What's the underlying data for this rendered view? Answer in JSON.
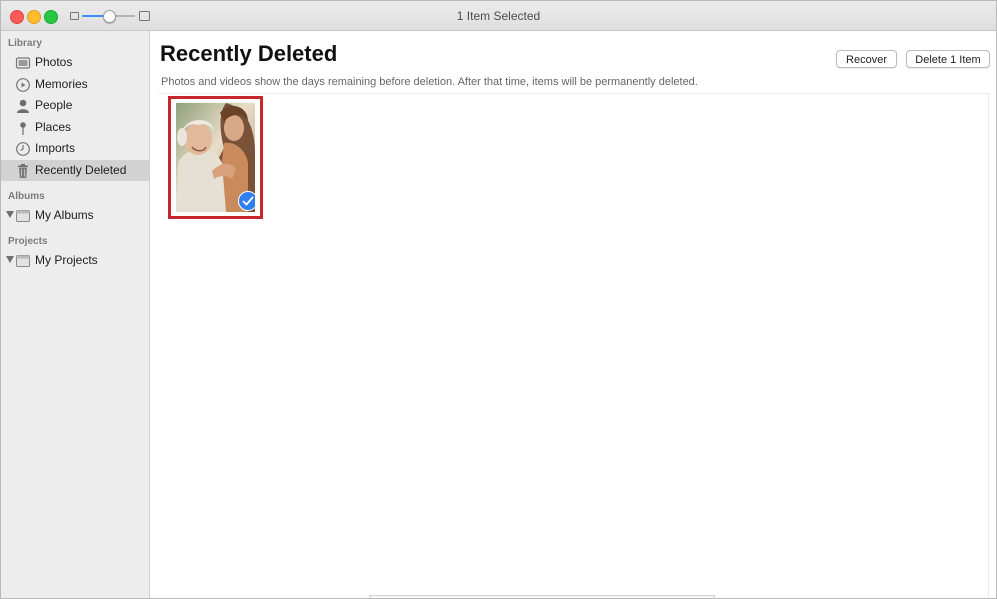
{
  "window": {
    "title": "1 Item Selected"
  },
  "toolbar": {
    "zoom_level": 0.5
  },
  "sidebar": {
    "sections": [
      {
        "label": "Library",
        "items": [
          {
            "label": "Photos",
            "icon": "photos-icon"
          },
          {
            "label": "Memories",
            "icon": "memories-icon"
          },
          {
            "label": "People",
            "icon": "people-icon"
          },
          {
            "label": "Places",
            "icon": "places-icon"
          },
          {
            "label": "Imports",
            "icon": "imports-icon"
          },
          {
            "label": "Recently Deleted",
            "icon": "trash-icon",
            "selected": true
          }
        ]
      },
      {
        "label": "Albums",
        "items": [
          {
            "label": "My Albums",
            "icon": "folder-icon"
          }
        ]
      },
      {
        "label": "Projects",
        "items": [
          {
            "label": "My Projects",
            "icon": "folder-icon"
          }
        ]
      }
    ]
  },
  "main": {
    "title": "Recently Deleted",
    "subtitle": "Photos and videos show the days remaining before deletion. After that time, items will be permanently deleted.",
    "recover_label": "Recover",
    "delete_label": "Delete 1 Item",
    "photos": [
      {
        "selected": true
      }
    ]
  },
  "colors": {
    "accent": "#2f7ff0",
    "selection_outline": "#c8262d"
  }
}
